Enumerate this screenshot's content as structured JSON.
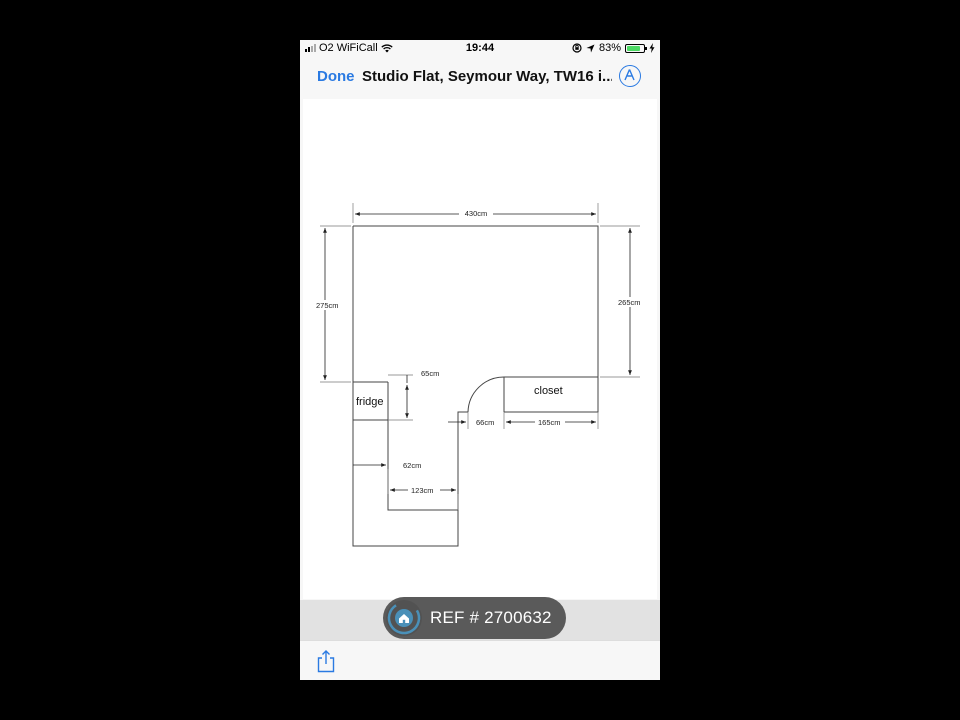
{
  "status_bar": {
    "carrier": "O2 WiFiCall",
    "time": "19:44",
    "battery_percent": "83%",
    "battery_level": 0.83,
    "icons": [
      "signal-icon",
      "wifi-icon",
      "orientation-lock-icon",
      "location-icon",
      "battery-icon",
      "charging-icon"
    ]
  },
  "nav": {
    "done_label": "Done",
    "title": "Studio Flat, Seymour Way, TW16 i...",
    "markup_icon": "markup-pen-icon"
  },
  "floor_plan": {
    "top_width": "430cm",
    "left_height": "275cm",
    "right_height": "265cm",
    "fridge_depth": "65cm",
    "door_gap": "66cm",
    "closet_width": "165cm",
    "fridge_width": "62cm",
    "alcove_width": "123cm",
    "fridge_label": "fridge",
    "closet_label": "closet"
  },
  "ref_badge": {
    "text": "REF # 2700632",
    "logo_icon": "house-icon",
    "colors": {
      "badge": "#5a5a5a",
      "logo_ring": "#4a90b8"
    }
  },
  "toolbar": {
    "share_icon": "share-icon"
  },
  "colors": {
    "accent": "#2a7ae2",
    "battery": "#4cd964"
  }
}
